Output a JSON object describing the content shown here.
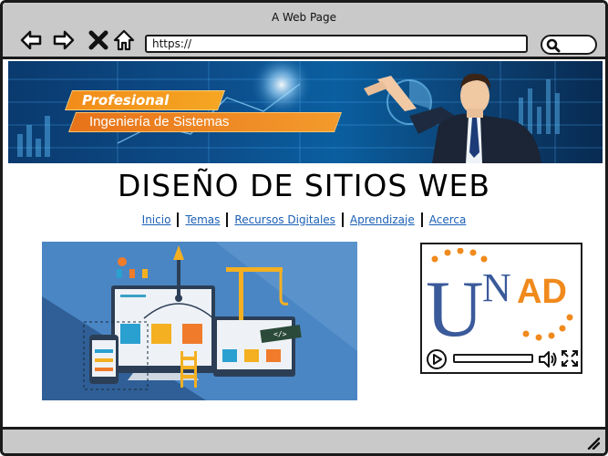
{
  "window": {
    "title": "A Web Page"
  },
  "browser": {
    "url": "https://",
    "icons": [
      "back-arrow-icon",
      "forward-arrow-icon",
      "close-x-icon",
      "home-icon",
      "search-icon"
    ]
  },
  "banner": {
    "line1": "Profesional",
    "line2": "Ingeniería de Sistemas"
  },
  "page": {
    "title": "DISEÑO DE SITIOS WEB"
  },
  "nav": {
    "links": [
      "Inicio",
      "Temas",
      "Recursos Digitales",
      "Aprendizaje",
      "Acerca"
    ]
  },
  "video": {
    "logo_text": "UNAD",
    "logo_u": "U",
    "logo_n": "N",
    "logo_ad": "AD"
  },
  "colors": {
    "accent": "#f28c1a",
    "link": "#1a5fb4",
    "chrome": "#c9c9c9",
    "unad_blue": "#3a5a9a",
    "unad_orange": "#f08a1c"
  }
}
